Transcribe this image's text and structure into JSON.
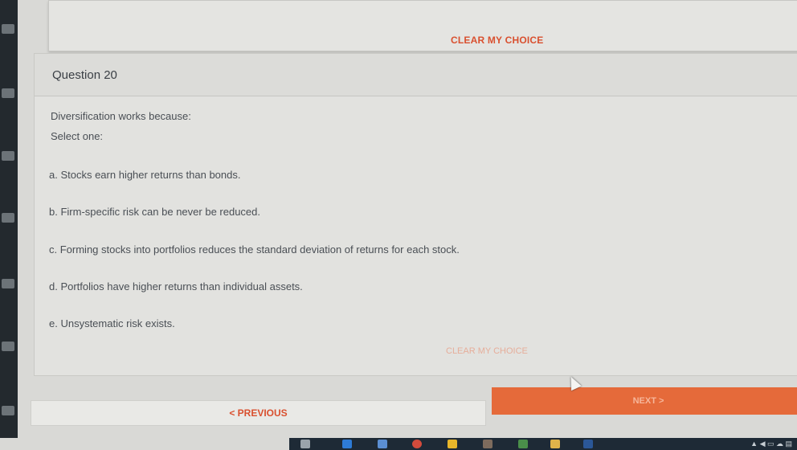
{
  "top": {
    "clear_choice": "CLEAR MY CHOICE"
  },
  "question": {
    "title": "Question 20",
    "text": "Diversification works because:",
    "select_prompt": "Select one:",
    "options": [
      "a. Stocks earn higher returns than bonds.",
      "b. Firm-specific risk can be never be reduced.",
      "c. Forming stocks into portfolios reduces the standard deviation of returns for each stock.",
      "d. Portfolios have higher returns than individual assets.",
      "e. Unsystematic risk exists."
    ],
    "clear_choice": "CLEAR MY CHOICE"
  },
  "nav": {
    "previous": "< PREVIOUS",
    "next": "NEXT >"
  },
  "colors": {
    "accent": "#d9502f",
    "next_button": "#e56a3a",
    "taskbar": "#1e2a36"
  },
  "taskbar_icons": [
    "task-view-icon",
    "edge-icon",
    "mail-icon",
    "chrome-icon",
    "sticky-icon",
    "photos-icon",
    "store-icon",
    "folder-icon",
    "word-icon"
  ]
}
